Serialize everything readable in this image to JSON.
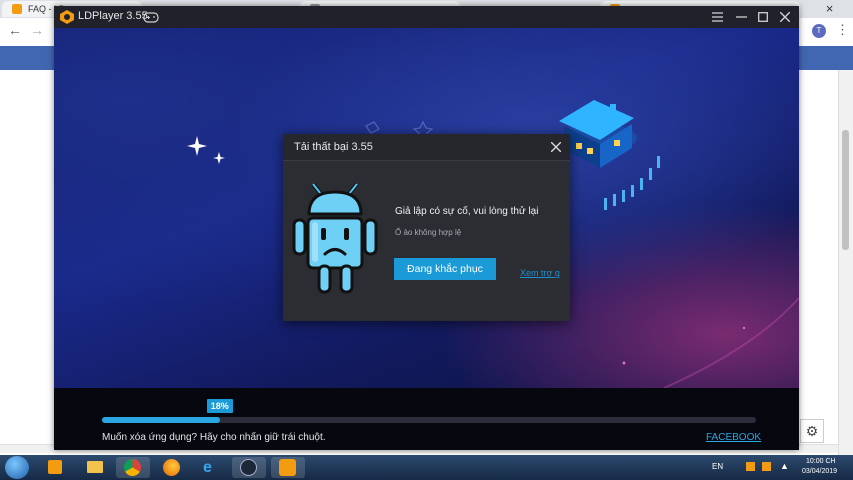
{
  "browser": {
    "tabs": [
      {
        "label": "FAQ - LD"
      },
      {
        "label": ""
      },
      {
        "label": ""
      },
      {
        "label": ""
      }
    ],
    "avatar_letter": "T",
    "close_glyph": "×"
  },
  "app": {
    "title": "LDPlayer 3.55",
    "progress_percent": 18,
    "progress_label": "18%",
    "tip_text": "Muốn xóa ứng dụng? Hãy cho nhấn giữ trái chuột.",
    "facebook_link": "FACEBOOK"
  },
  "dialog": {
    "title": "Tải thất bại 3.55",
    "message": "Giả lập có sự cố, vui lòng thử lại",
    "sub_message": "Ổ ảo không hợp lệ",
    "repair_button": "Đang khắc phục",
    "help_link": "Xem trợ g"
  },
  "taskbar": {
    "language": "EN",
    "time": "10:00 CH",
    "date": "03/04/2019"
  },
  "colors": {
    "accent": "#1a9ad6",
    "link": "#1f8fd6",
    "titlebar": "#20212b",
    "dialog": "#2b2d33",
    "facebook": "#4267b2"
  },
  "icons": [
    "ldplayer-logo-icon",
    "gamepad-icon",
    "menu-icon",
    "minimize-icon",
    "maximize-icon",
    "close-icon",
    "sad-robot-icon",
    "back-icon",
    "forward-icon",
    "reload-icon",
    "gear-icon",
    "start-icon"
  ]
}
